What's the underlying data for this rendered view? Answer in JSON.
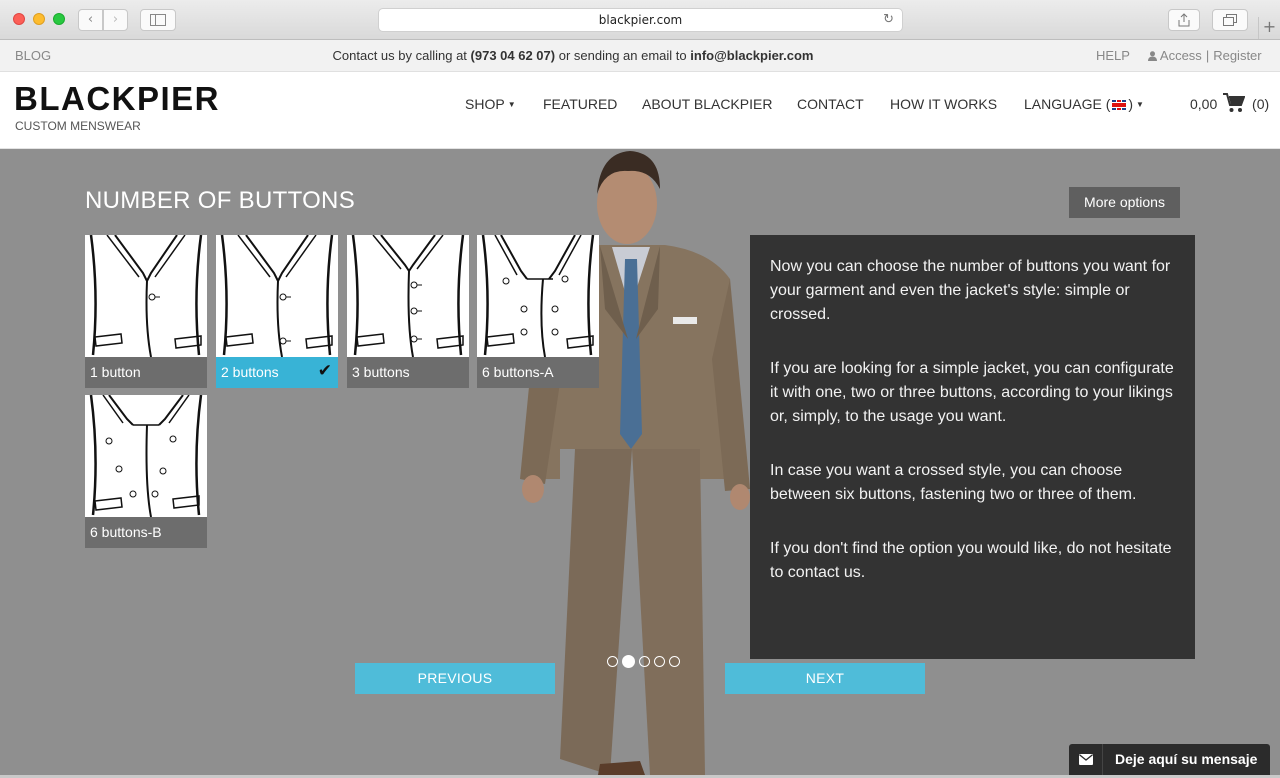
{
  "browser": {
    "url": "blackpier.com",
    "back_icon": "‹",
    "forward_icon": "›"
  },
  "topbar": {
    "blog": "BLOG",
    "contact_prefix": "Contact us by calling at",
    "phone": "(973 04 62 07)",
    "contact_middle": "or sending an email to",
    "email": "info@blackpier.com",
    "help": "HELP",
    "access": "Access",
    "separator": "|",
    "register": "Register"
  },
  "header": {
    "logo": "BLACKPIER",
    "tagline": "CUSTOM MENSWEAR",
    "menu": {
      "shop": "SHOP",
      "featured": "FEATURED",
      "about": "ABOUT BLACKPIER",
      "contact": "CONTACT",
      "how": "HOW IT WORKS",
      "language_prefix": "LANGUAGE (",
      "language_suffix": ")"
    },
    "cart": {
      "amount": "0,00",
      "count": "(0)"
    }
  },
  "configurator": {
    "title": "NUMBER OF BUTTONS",
    "more_options": "More options",
    "options": [
      {
        "label": "1 button",
        "selected": false
      },
      {
        "label": "2 buttons",
        "selected": true
      },
      {
        "label": "3 buttons",
        "selected": false
      },
      {
        "label": "6 buttons-A",
        "selected": false
      },
      {
        "label": "6 buttons-B",
        "selected": false
      }
    ],
    "info": [
      "Now you can choose the number of buttons you want for your garment and even the jacket's style: simple or crossed.",
      "If you are looking for a simple jacket, you can configurate it with one, two or three buttons, according to your likings or, simply, to the usage you want.",
      "In case you want a crossed style, you can choose between six buttons, fastening two or three of them.",
      "If you don't find the option you would like, do not hesitate to contact us."
    ],
    "step_current": 2,
    "step_total": 5,
    "previous": "PREVIOUS",
    "next": "NEXT"
  },
  "chat": {
    "label": "Deje aquí su mensaje"
  },
  "colors": {
    "accent": "#4fbcd9",
    "selected": "#38b3d6",
    "panel": "#333333",
    "hero_bg": "#8f8f8f"
  }
}
